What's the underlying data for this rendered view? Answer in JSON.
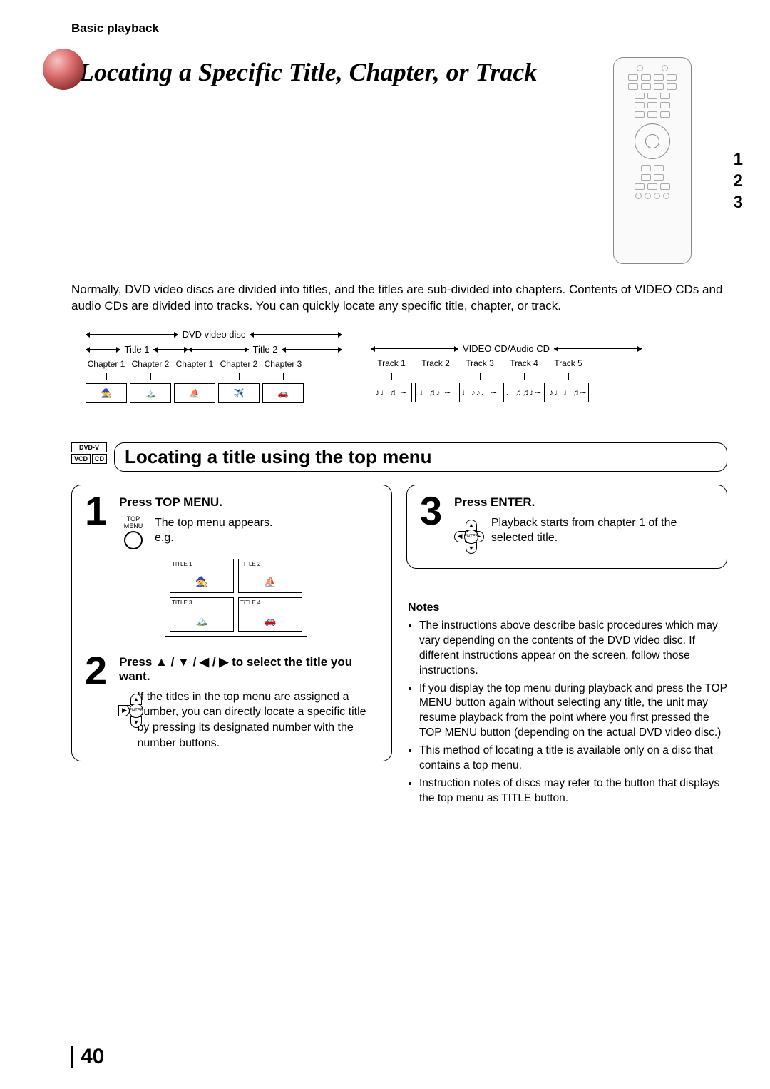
{
  "breadcrumb": "Basic playback",
  "page_title": "Locating a Specific Title, Chapter, or Track",
  "remote_callouts": [
    "1",
    "2",
    "3"
  ],
  "intro": "Normally, DVD video discs are divided into titles, and the titles are sub-divided into chapters. Contents of VIDEO CDs and audio CDs are divided into tracks. You can quickly locate any specific title, chapter, or track.",
  "dvd_diagram": {
    "label": "DVD video disc",
    "titles": [
      {
        "name": "Title 1",
        "chapters": [
          "Chapter 1",
          "Chapter 2"
        ]
      },
      {
        "name": "Title 2",
        "chapters": [
          "Chapter 1",
          "Chapter 2",
          "Chapter 3"
        ]
      }
    ]
  },
  "cd_diagram": {
    "label": "VIDEO CD/Audio CD",
    "tracks": [
      "Track 1",
      "Track 2",
      "Track 3",
      "Track 4",
      "Track 5"
    ]
  },
  "disc_badges": {
    "top": "DVD-V",
    "left": "VCD",
    "right": "CD"
  },
  "section_title": "Locating a title using the top menu",
  "step1": {
    "num": "1",
    "head": "Press TOP MENU.",
    "icon_label": "TOP MENU",
    "line1": "The top menu appears.",
    "eg": "e.g.",
    "tiles": [
      "TITLE 1",
      "TITLE 2",
      "TITLE 3",
      "TITLE 4"
    ]
  },
  "step2": {
    "num": "2",
    "head": "Press ▲ / ▼ / ◀ / ▶ to select the title you want.",
    "body": "If the titles in the top menu are assigned a number, you can directly locate a specific title by pressing its designated number with the number buttons.",
    "enter": "ENTER"
  },
  "step3": {
    "num": "3",
    "head": "Press ENTER.",
    "body": "Playback starts from chapter 1 of the selected title.",
    "enter": "ENTER"
  },
  "notes_head": "Notes",
  "notes": [
    "The instructions above describe basic procedures which may vary depending on the contents of the DVD video disc. If different instructions appear on the screen, follow those instructions.",
    "If you display the top menu during playback and press the TOP MENU button again without selecting any title, the unit may resume playback from the point where you first pressed the TOP MENU button (depending on the actual DVD video disc.)",
    "This method of locating a title is available only on a disc that contains a top menu.",
    "Instruction notes of discs may refer to the button that displays the top menu as TITLE button."
  ],
  "page_number": "40"
}
